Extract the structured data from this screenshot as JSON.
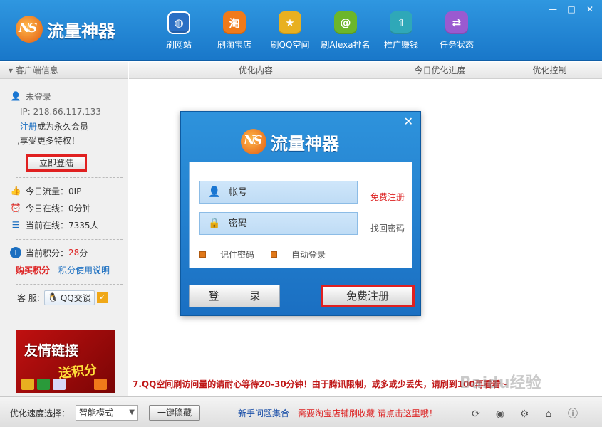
{
  "app": {
    "title": "流量神器"
  },
  "window": {
    "minimize": "—",
    "maximize": "□",
    "close": "✕"
  },
  "nav": [
    {
      "label": "刷网站",
      "icon": "globe-icon",
      "glyph": "◍",
      "color": "#2a6fc4"
    },
    {
      "label": "刷淘宝店",
      "icon": "taobao-icon",
      "glyph": "淘",
      "color": "#f07a1a"
    },
    {
      "label": "刷QQ空间",
      "icon": "star-icon",
      "glyph": "★",
      "color": "#e8b020"
    },
    {
      "label": "刷Alexa排名",
      "icon": "at-icon",
      "glyph": "@",
      "color": "#6cb62a"
    },
    {
      "label": "推广赚钱",
      "icon": "rocket-icon",
      "glyph": "⇧",
      "color": "#2fa8b8"
    },
    {
      "label": "任务状态",
      "icon": "swap-icon",
      "glyph": "⇄",
      "color": "#9a5ad0"
    }
  ],
  "sidebar": {
    "header": "客户端信息",
    "status": "未登录",
    "ip": "IP: 218.66.117.133",
    "register_link": "注册",
    "register_text": "成为永久会员",
    "privilege_text": ",享受更多特权！",
    "login_button": "立即登陆",
    "today_traffic": "今日流量：0IP",
    "today_online": "今日在线：0分钟",
    "current_online": "当前在线：7335人",
    "points_label": "当前积分：",
    "points_value": "28",
    "points_unit": "分",
    "buy_points": "购买积分",
    "points_help": "积分使用说明",
    "service_label": "客 服:",
    "qq_chat": "QQ交谈",
    "banner_title": "友情链接",
    "banner_sub": "送积分"
  },
  "columns": [
    "优化内容",
    "今日优化进度",
    "优化控制"
  ],
  "ticker": "7.QQ空间刷访问量的请耐心等待20-30分钟！由于腾讯限制，或多或少丢失，请刷到100再看看~",
  "dialog": {
    "title": "流量神器",
    "close": "✕",
    "username_placeholder": "帐号",
    "password_placeholder": "密码",
    "free_register_link": "免费注册",
    "recover_password": "找回密码",
    "remember_password": "记住密码",
    "auto_login": "自动登录",
    "login_button": "登　录",
    "register_button": "免费注册"
  },
  "footer": {
    "speed_label": "优化速度选择：",
    "speed_value": "智能模式",
    "hide_button": "一键隐藏",
    "faq_link": "新手问题集合",
    "promo_link": "需要淘宝店铺刷收藏 请点击这里哦！"
  },
  "watermark": "Baidu经验"
}
